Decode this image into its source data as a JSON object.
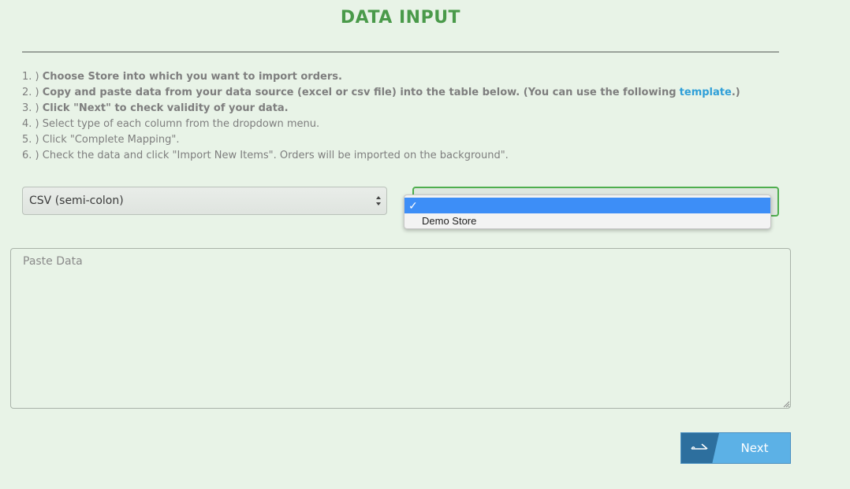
{
  "header": {
    "title": "DATA INPUT"
  },
  "steps": [
    {
      "number": "1. )",
      "bold": "Choose Store into which you want to import orders."
    },
    {
      "number": "2. )",
      "bold": "Copy and paste data from your data source (excel or csv file) into the table below. (You can use the following",
      "link": "template",
      "after": ".)"
    },
    {
      "number": "3. )",
      "bold": "Click \"Next\" to check validity of your data."
    },
    {
      "number": "4. )",
      "text": "Select type of each column from the dropdown menu."
    },
    {
      "number": "5. )",
      "text": "Click \"Complete Mapping\"."
    },
    {
      "number": "6. )",
      "text": "Check the data and click \"Import New Items\". Orders will be imported on the background\"."
    }
  ],
  "format_select": {
    "value": "CSV (semi-colon)"
  },
  "store_select": {
    "options": [
      {
        "label": "",
        "selected": true,
        "check": "✓"
      },
      {
        "label": "Demo Store",
        "selected": false
      }
    ]
  },
  "paste": {
    "placeholder": "Paste Data",
    "value": ""
  },
  "next_button": {
    "label": "Next",
    "icon": "arrow-right-icon"
  },
  "colors": {
    "title_green": "#4a9a4a",
    "link_blue": "#2f9fd8",
    "button_blue": "#5cb1e6",
    "button_dark_blue": "#2d6f9e",
    "dropdown_highlight": "#3d8ef7",
    "background": "#e8f3e7"
  }
}
